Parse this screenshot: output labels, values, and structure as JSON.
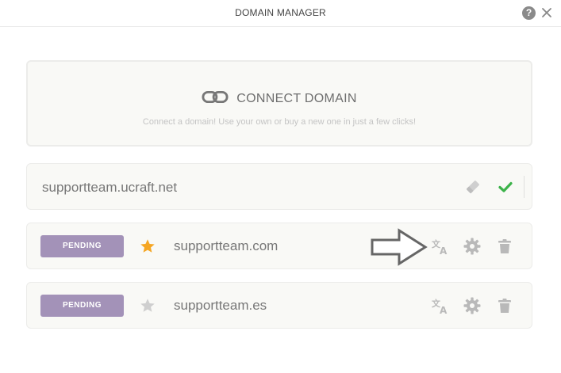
{
  "header": {
    "title": "DOMAIN MANAGER",
    "help_glyph": "?",
    "help_icon": "question-circle-icon",
    "close_icon": "close-icon"
  },
  "connect": {
    "icon": "link-icon",
    "label": "CONNECT DOMAIN",
    "subtitle": "Connect a domain! Use your own or buy a new one in just a few clicks!"
  },
  "edit_row": {
    "value": "supportteam.ucraft.net",
    "actions": [
      "eraser-icon",
      "check-icon"
    ]
  },
  "domains": [
    {
      "status": "PENDING",
      "name": "supportteam.com",
      "primary": true,
      "actions": [
        "translate-icon",
        "gear-icon",
        "trash-icon"
      ]
    },
    {
      "status": "PENDING",
      "name": "supportteam.es",
      "primary": false,
      "actions": [
        "translate-icon",
        "gear-icon",
        "trash-icon"
      ]
    }
  ],
  "colors": {
    "badge": "#a392b8",
    "star_active": "#f5a623",
    "star_inactive": "#cfcfcf",
    "check": "#3cb34a",
    "icon": "#b9b9b9"
  }
}
